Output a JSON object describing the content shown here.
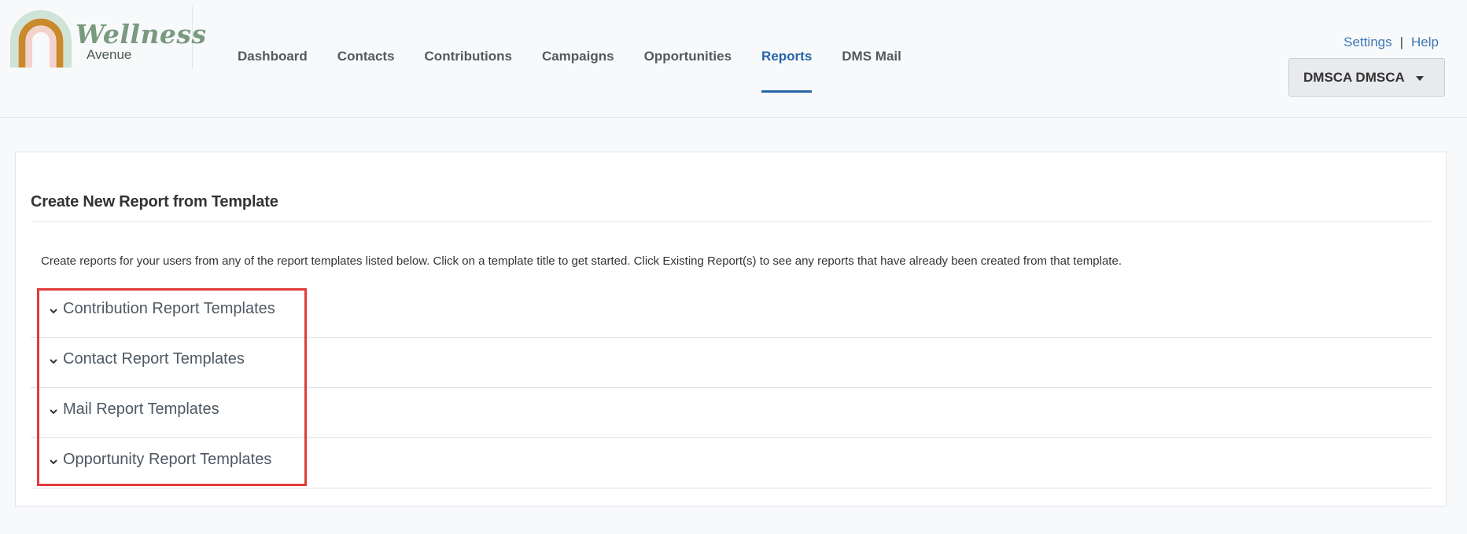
{
  "logo": {
    "name": "Wellness",
    "sub": "Avenue"
  },
  "nav": {
    "items": [
      {
        "label": "Dashboard"
      },
      {
        "label": "Contacts"
      },
      {
        "label": "Contributions"
      },
      {
        "label": "Campaigns"
      },
      {
        "label": "Opportunities"
      },
      {
        "label": "Reports",
        "active": true
      },
      {
        "label": "DMS Mail"
      }
    ]
  },
  "toplinks": {
    "settings": "Settings",
    "separator": "|",
    "help": "Help"
  },
  "user": {
    "name": "DMSCA DMSCA"
  },
  "main": {
    "title": "Create New Report from Template",
    "intro": "Create reports for your users from any of the report templates listed below. Click on a template title to get started. Click Existing Report(s) to see any reports that have already been created from that template.",
    "sections": [
      {
        "label": "Contribution Report Templates"
      },
      {
        "label": "Contact Report Templates"
      },
      {
        "label": "Mail Report Templates"
      },
      {
        "label": "Opportunity Report Templates"
      }
    ]
  },
  "colors": {
    "accent": "#2566a8",
    "highlight": "#e23a3a",
    "link": "#3e78b3"
  }
}
